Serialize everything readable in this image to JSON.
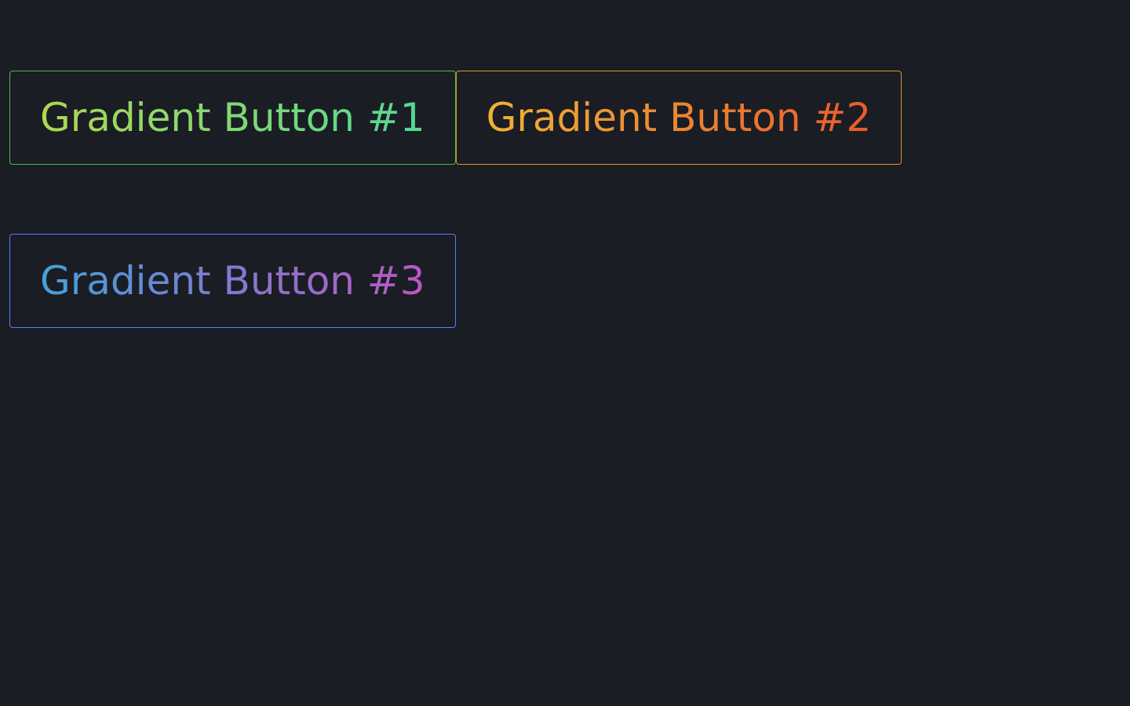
{
  "buttons": [
    {
      "label": "Gradient Button #1"
    },
    {
      "label": "Gradient Button #2"
    },
    {
      "label": "Gradient Button #3"
    }
  ]
}
